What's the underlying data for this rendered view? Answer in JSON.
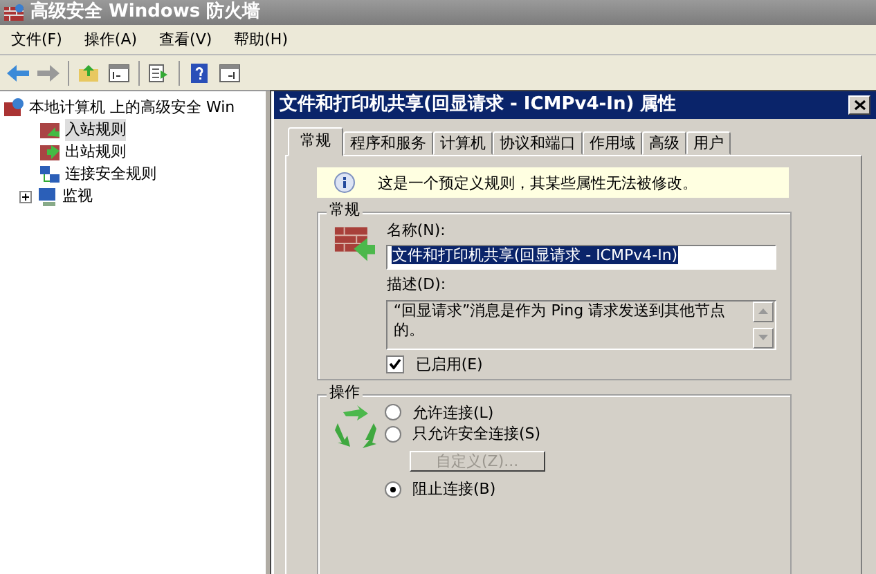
{
  "window": {
    "title": "高级安全 Windows 防火墙"
  },
  "menu": [
    "文件(F)",
    "操作(A)",
    "查看(V)",
    "帮助(H)"
  ],
  "tree": [
    {
      "label": "本地计算机 上的高级安全 Win",
      "selected": false,
      "expanded": true,
      "children": [
        {
          "label": "入站规则",
          "selected": true
        },
        {
          "label": "出站规则",
          "selected": false
        },
        {
          "label": "连接安全规则",
          "selected": false
        },
        {
          "label": "监视",
          "selected": false,
          "expanded": false
        }
      ]
    }
  ],
  "dialog": {
    "title": "文件和打印机共享(回显请求 - ICMPv4-In) 属性",
    "tabs": [
      {
        "label": "常规",
        "selected": true
      },
      {
        "label": "程序和服务",
        "selected": false
      },
      {
        "label": "计算机",
        "selected": false
      },
      {
        "label": "协议和端口",
        "selected": false
      },
      {
        "label": "作用域",
        "selected": false
      },
      {
        "label": "高级",
        "selected": false
      },
      {
        "label": "用户",
        "selected": false
      }
    ],
    "info": "这是一个预定义规则，其某些属性无法被修改。",
    "general": {
      "title": "常规",
      "name_label": "名称(N):",
      "name": "文件和打印机共享(回显请求 - ICMPv4-In)",
      "description_label": "描述(D):",
      "description": "“回显请求”消息是作为 Ping 请求发送到其他节点的。",
      "enabled": {
        "label": "已启用(E)",
        "checked": true
      }
    },
    "action": {
      "title": "操作",
      "options": [
        {
          "label": "允许连接(L)",
          "selected": false
        },
        {
          "label": "只允许安全连接(S)",
          "selected": false
        },
        {
          "label": "阻止连接(B)",
          "selected": true
        }
      ],
      "customize": {
        "label": "自定义(Z)...",
        "disabled": true
      }
    }
  }
}
